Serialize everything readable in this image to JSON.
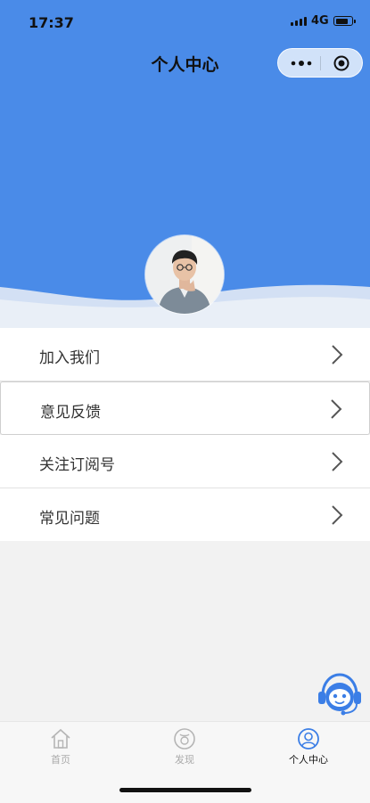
{
  "status_bar": {
    "time": "17:37",
    "network": "4G"
  },
  "nav": {
    "title": "个人中心"
  },
  "menu": {
    "items": [
      {
        "label": "加入我们"
      },
      {
        "label": "意见反馈"
      },
      {
        "label": "关注订阅号"
      },
      {
        "label": "常见问题"
      }
    ]
  },
  "tabbar": {
    "tabs": [
      {
        "label": "首页",
        "icon": "home-icon",
        "active": false
      },
      {
        "label": "发现",
        "icon": "discover-icon",
        "active": false
      },
      {
        "label": "个人中心",
        "icon": "user-icon",
        "active": true
      }
    ]
  },
  "colors": {
    "header_blue": "#4a8be8",
    "tab_active": "#3b7ee6",
    "tab_inactive": "#b5b5b5"
  },
  "floating": {
    "icon": "customer-service-icon"
  }
}
